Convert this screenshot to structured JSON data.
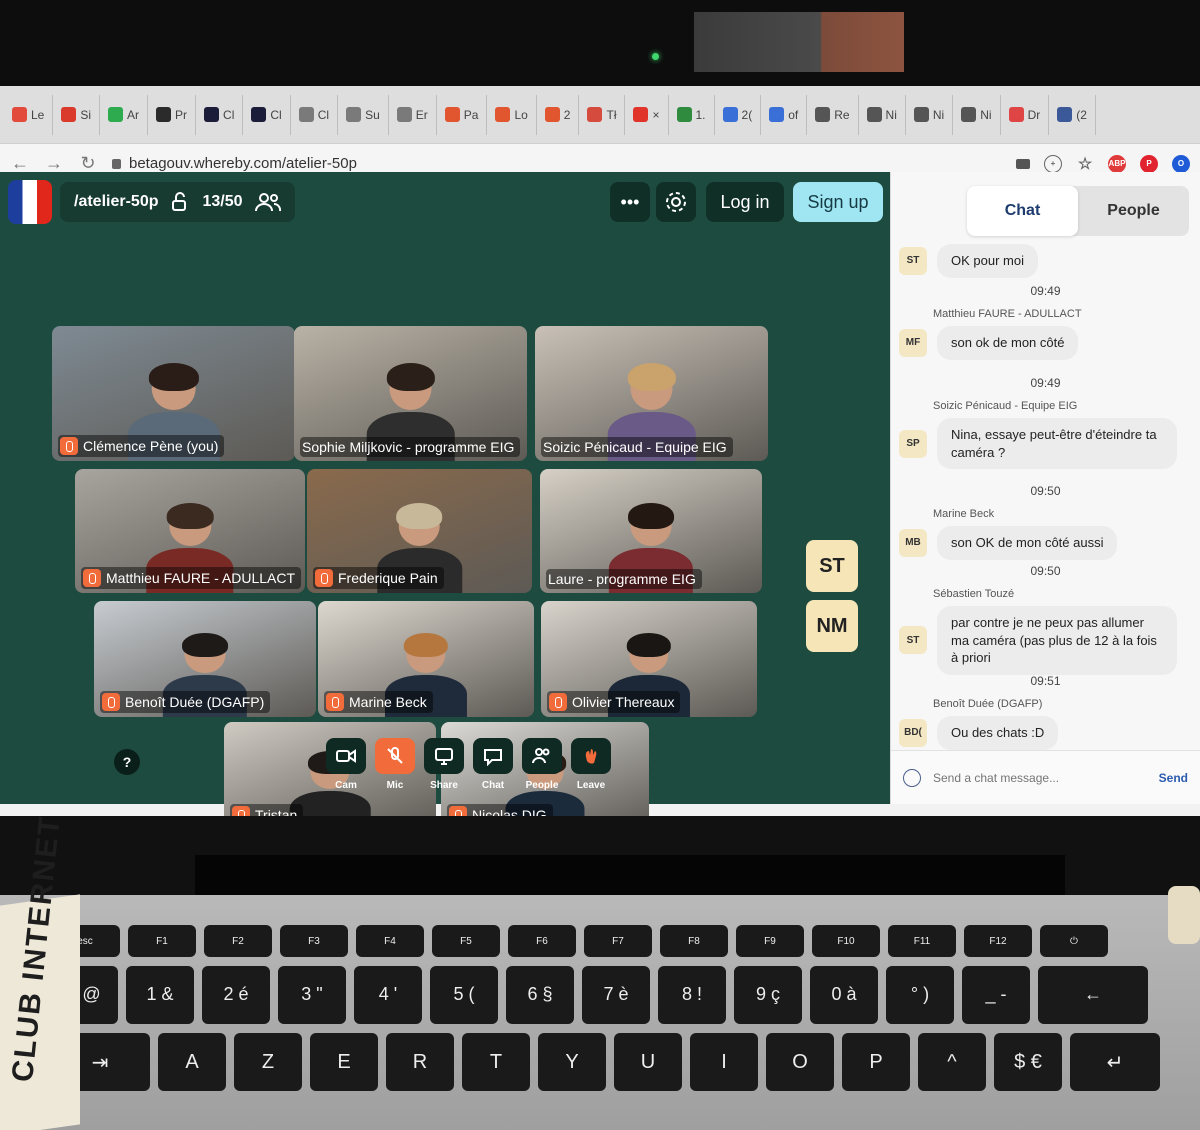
{
  "browser": {
    "tabs": [
      {
        "label": "Le",
        "color": "#e24a3b",
        "icon": "red-circle-icon"
      },
      {
        "label": "Si",
        "color": "#d93a2b",
        "icon": "square-icon"
      },
      {
        "label": "Ar",
        "color": "#2eaa4f",
        "icon": "c-icon"
      },
      {
        "label": "Pr",
        "color": "#2b2b2b",
        "icon": "m-icon"
      },
      {
        "label": "Cl",
        "color": "#1b1b3a",
        "icon": "d-icon"
      },
      {
        "label": "Cl",
        "color": "#1b1b3a",
        "icon": "d-icon"
      },
      {
        "label": "Cl",
        "color": "#7a7a7a",
        "icon": "circle-icon"
      },
      {
        "label": "Su",
        "color": "#7a7a7a",
        "icon": "circle-icon"
      },
      {
        "label": "Er",
        "color": "#7a7a7a",
        "icon": "circle-icon"
      },
      {
        "label": "Pa",
        "color": "#e1552f",
        "icon": "orange-icon"
      },
      {
        "label": "Lo",
        "color": "#e1552f",
        "icon": "orange-icon"
      },
      {
        "label": "2",
        "color": "#e1552f",
        "icon": "orange-icon"
      },
      {
        "label": "Tł",
        "color": "#d54b3d",
        "icon": "gmail-icon"
      },
      {
        "label": "×",
        "color": "#e0342b",
        "icon": "record-icon"
      },
      {
        "label": "1.",
        "color": "#2f8c3f",
        "icon": "drive-icon"
      },
      {
        "label": "2(",
        "color": "#3a6fd8",
        "icon": "docs-icon"
      },
      {
        "label": "of",
        "color": "#3a6fd8",
        "icon": "docs-icon"
      },
      {
        "label": "Re",
        "color": "#555555",
        "icon": "at-icon"
      },
      {
        "label": "Ni",
        "color": "#555555",
        "icon": "at-icon"
      },
      {
        "label": "Ni",
        "color": "#555555",
        "icon": "at-icon"
      },
      {
        "label": "Ni",
        "color": "#555555",
        "icon": "at-icon"
      },
      {
        "label": "Dr",
        "color": "#e04545",
        "icon": "window-icon"
      },
      {
        "label": "(2",
        "color": "#3b5998",
        "icon": "facebook-icon"
      }
    ],
    "url": "betagouv.whereby.com/atelier-50p"
  },
  "room": {
    "name": "/atelier-50p",
    "count": "13/50",
    "login_label": "Log in",
    "signup_label": "Sign up",
    "more_label": "•••",
    "participants": [
      {
        "name": "Clémence Pène (you)",
        "bg": "#7e8a93",
        "hair": "#2a1c16",
        "body": "#5a6a78",
        "muted": true
      },
      {
        "name": "Sophie Miljkovic - programme EIG",
        "bg": "#b9b2a6",
        "hair": "#2b1f1a",
        "body": "#2e2e2e",
        "muted": false
      },
      {
        "name": "Soizic Pénicaud - Equipe EIG",
        "bg": "#c9c1b7",
        "hair": "#c9a26c",
        "body": "#6a5a88",
        "muted": false
      },
      {
        "name": "Matthieu FAURE - ADULLACT",
        "bg": "#a8a49e",
        "hair": "#3a2a20",
        "body": "#7a2a24",
        "muted": true
      },
      {
        "name": "Frederique Pain",
        "bg": "#8a6a4c",
        "hair": "#c8b89a",
        "body": "#2b2b2b",
        "muted": true
      },
      {
        "name": "Laure - programme EIG",
        "bg": "#d6d0c6",
        "hair": "#241812",
        "body": "#7a2c30",
        "muted": false
      },
      {
        "name": "Benoît Duée (DGAFP)",
        "bg": "#c7ccd1",
        "hair": "#1e1a18",
        "body": "#2d3a4a",
        "muted": true
      },
      {
        "name": "Marine Beck",
        "bg": "#ddd8cf",
        "hair": "#b6773f",
        "body": "#1f2a3a",
        "muted": true
      },
      {
        "name": "Olivier Thereaux",
        "bg": "#d8d4cc",
        "hair": "#1a1614",
        "body": "#1c2838",
        "muted": true
      },
      {
        "name": "Tristan",
        "bg": "#cfcac2",
        "hair": "#1f1a18",
        "body": "#222222",
        "muted": true
      },
      {
        "name": "Nicolas DIG",
        "bg": "#dcdad6",
        "hair": "#2a1d14",
        "body": "#1b2b3c",
        "muted": true
      }
    ],
    "initials": [
      "ST",
      "NM"
    ],
    "help_label": "?",
    "toolbar": [
      {
        "label": "Cam",
        "icon": "camera-icon"
      },
      {
        "label": "Mic",
        "icon": "mic-muted-icon"
      },
      {
        "label": "Share",
        "icon": "screen-share-icon"
      },
      {
        "label": "Chat",
        "icon": "chat-icon"
      },
      {
        "label": "People",
        "icon": "people-icon"
      },
      {
        "label": "Leave",
        "icon": "wave-hand-icon"
      }
    ]
  },
  "chat": {
    "tab_chat": "Chat",
    "tab_people": "People",
    "messages": [
      {
        "time": "",
        "author": "",
        "initials": "ST",
        "text": "OK pour moi"
      },
      {
        "time": "09:49",
        "author": "Matthieu FAURE - ADULLACT",
        "initials": "MF",
        "text": "son ok de mon côté"
      },
      {
        "time": "09:49",
        "author": "Soizic Pénicaud - Equipe EIG",
        "initials": "SP",
        "text": "Nina, essaye peut-être d'éteindre ta caméra ?"
      },
      {
        "time": "09:50",
        "author": "Marine Beck",
        "initials": "MB",
        "text": "son OK de mon côté aussi"
      },
      {
        "time": "09:50",
        "author": "Sébastien Touzé",
        "initials": "ST",
        "text": "par contre je ne peux pas allumer ma caméra (pas plus de 12 à la fois à priori"
      },
      {
        "time": "09:51",
        "author": "Benoît Duée (DGAFP)",
        "initials": "BD(",
        "text": "Ou des chats :D"
      }
    ],
    "placeholder": "Send a chat message...",
    "send_label": "Send"
  },
  "keyboard": {
    "fn_row": [
      "esc",
      "F1",
      "F2",
      "F3",
      "F4",
      "F5",
      "F6",
      "F7",
      "F8",
      "F9",
      "F10",
      "F11",
      "F12",
      "⏻"
    ],
    "num_row": [
      "# @",
      "1 &",
      "2 é",
      "3 \"",
      "4 '",
      "5 (",
      "6 §",
      "7 è",
      "8 !",
      "9 ç",
      "0 à",
      "° )",
      "_ -",
      "←"
    ],
    "alpha_row": [
      "⇥",
      "A",
      "Z",
      "E",
      "R",
      "T",
      "Y",
      "U",
      "I",
      "O",
      "P",
      "^",
      "$ €",
      "↵"
    ]
  },
  "sticker_text": "CLUB INTERNET"
}
